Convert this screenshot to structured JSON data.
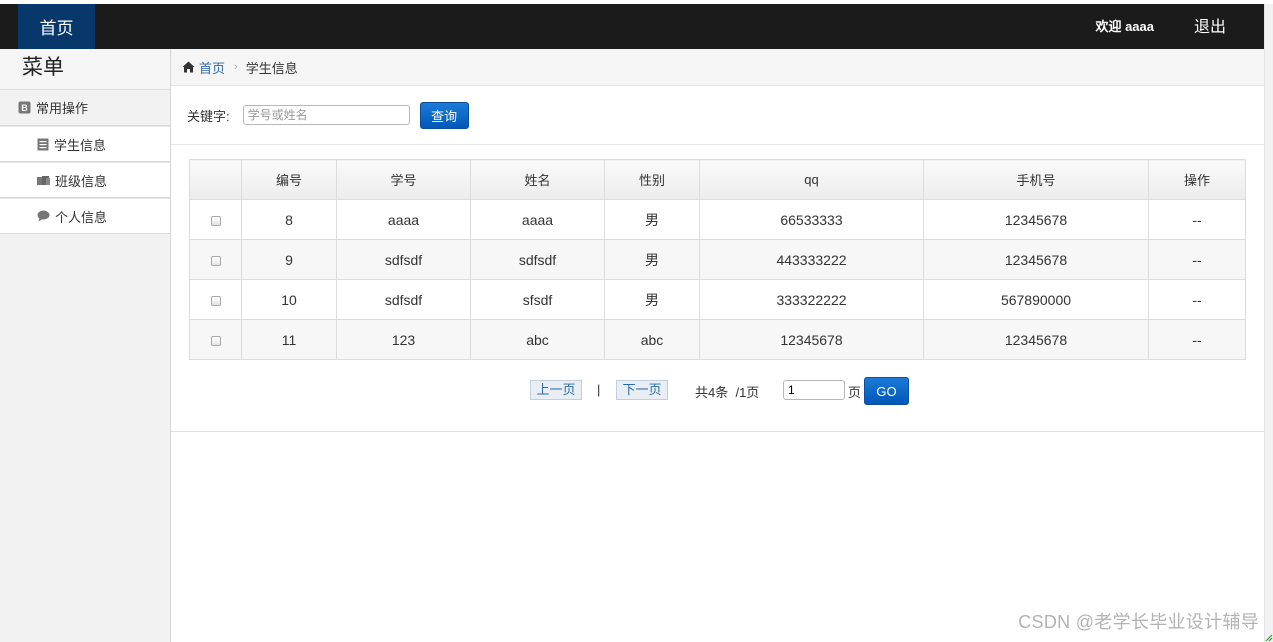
{
  "topbar": {
    "home_tab": "首页",
    "welcome": "欢迎 aaaa",
    "logout": "退出"
  },
  "sidebar": {
    "title": "菜单",
    "group_label": "常用操作",
    "items": [
      {
        "label": "学生信息",
        "icon": "document-icon"
      },
      {
        "label": "班级信息",
        "icon": "group-icon"
      },
      {
        "label": "个人信息",
        "icon": "chat-bubble-icon"
      }
    ]
  },
  "breadcrumb": {
    "home": "首页",
    "current": "学生信息"
  },
  "search": {
    "label": "关键字:",
    "placeholder": "学号或姓名",
    "button": "查询"
  },
  "table": {
    "headers": [
      "",
      "编号",
      "学号",
      "姓名",
      "性别",
      "qq",
      "手机号",
      "操作"
    ],
    "rows": [
      {
        "id": "8",
        "sno": "aaaa",
        "name": "aaaa",
        "gender": "男",
        "qq": "66533333",
        "phone": "12345678",
        "op": "--"
      },
      {
        "id": "9",
        "sno": "sdfsdf",
        "name": "sdfsdf",
        "gender": "男",
        "qq": "443333222",
        "phone": "12345678",
        "op": "--"
      },
      {
        "id": "10",
        "sno": "sdfsdf",
        "name": "sfsdf",
        "gender": "男",
        "qq": "333322222",
        "phone": "567890000",
        "op": "--"
      },
      {
        "id": "11",
        "sno": "123",
        "name": "abc",
        "gender": "abc",
        "qq": "12345678",
        "phone": "12345678",
        "op": "--"
      }
    ]
  },
  "pager": {
    "prev": "上一页",
    "separator": "|",
    "next": "下一页",
    "info": "共4条  /1页",
    "page_value": "1",
    "page_unit": "页",
    "go": "GO"
  },
  "watermark": "CSDN @老学长毕业设计辅导",
  "colors": {
    "topbar": "#1b1b1b",
    "home_tab": "#08386b",
    "button_blue": "#0057b8",
    "link": "#2a6aa5"
  }
}
